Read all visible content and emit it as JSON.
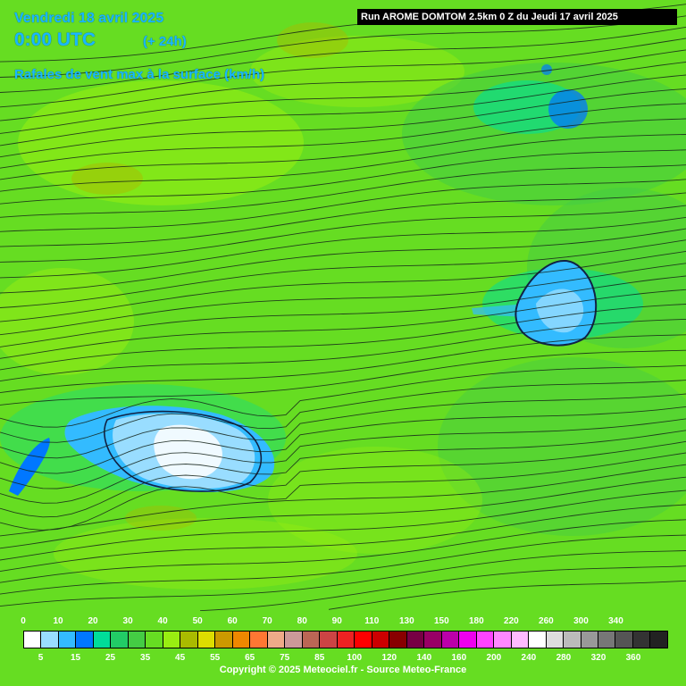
{
  "header": {
    "date": "Vendredi 18 avril 2025",
    "time": "0:00 UTC",
    "lead": "(+ 24h)",
    "parameter": "Rafales de vent max à la surface (km/h)",
    "run_label": "Run AROME DOMTOM 2.5km 0 Z du Jeudi 17 avril 2025"
  },
  "legend": {
    "top_labels": [
      "0",
      "10",
      "20",
      "30",
      "40",
      "50",
      "60",
      "70",
      "80",
      "90",
      "110",
      "130",
      "150",
      "180",
      "220",
      "260",
      "300",
      "340"
    ],
    "bottom_labels": [
      "5",
      "15",
      "25",
      "35",
      "45",
      "55",
      "65",
      "75",
      "85",
      "100",
      "120",
      "140",
      "160",
      "200",
      "240",
      "280",
      "320",
      "360"
    ],
    "colors": [
      "#ffffff",
      "#99ddff",
      "#33bbff",
      "#0077ff",
      "#00dd99",
      "#22cc66",
      "#44cc44",
      "#66dd22",
      "#99ee11",
      "#aabb00",
      "#dddd00",
      "#cc9900",
      "#ee8800",
      "#ff7733",
      "#eeaa88",
      "#cc9999",
      "#bb6655",
      "#cc4444",
      "#ee2222",
      "#ff0000",
      "#cc0000",
      "#880000",
      "#770044",
      "#990066",
      "#bb00aa",
      "#ee00ee",
      "#ff44ff",
      "#ff88ff",
      "#ffbbff",
      "#ffffff",
      "#dddddd",
      "#bbbbbb",
      "#999999",
      "#777777",
      "#555555",
      "#333333",
      "#222222"
    ]
  },
  "copyright": "Copyright © 2025 Meteociel.fr - Source Meteo-France",
  "colors": {
    "background": "#66dd22",
    "title_text": "#19b8ff",
    "run_box": "#000000"
  }
}
